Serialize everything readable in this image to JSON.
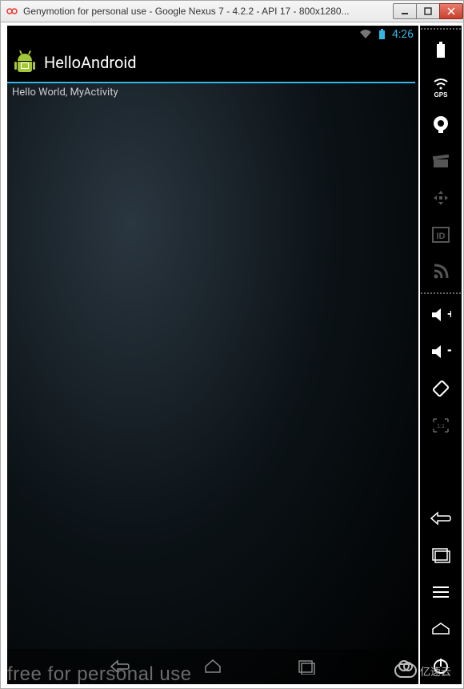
{
  "window": {
    "title": "Genymotion for personal use - Google Nexus 7 - 4.2.2 - API 17 - 800x1280..."
  },
  "status_bar": {
    "clock": "4:26"
  },
  "app": {
    "title": "HelloAndroid",
    "content_text": "Hello World, MyActivity"
  },
  "watermark": {
    "text": "free for personal use",
    "corner_text": "亿速云"
  },
  "side_toolbar": {
    "battery_label": "battery",
    "gps_label": "GPS",
    "camera_label": "camera",
    "clapper_label": "screencast",
    "move_label": "multitouch",
    "id_label": "identifiers",
    "rss_label": "network",
    "vol_up_label": "volume-up",
    "vol_down_label": "volume-down",
    "rotate_label": "rotate",
    "pixel_label": "pixel-perfect",
    "back_label": "back",
    "recent_label": "recent-apps",
    "menu_label": "menu",
    "home_label": "home",
    "power_label": "power"
  }
}
